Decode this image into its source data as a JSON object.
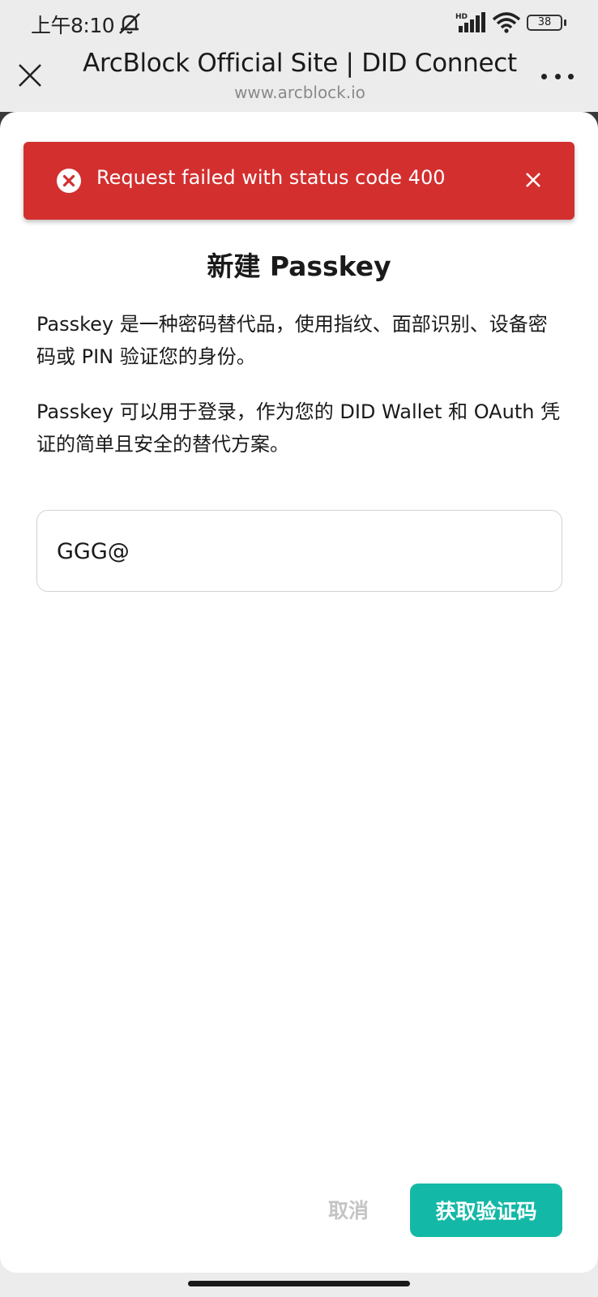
{
  "status_bar": {
    "time": "上午8:10",
    "battery": "38",
    "network_label": "HD"
  },
  "header": {
    "title": "ArcBlock Official Site | DID Connect",
    "url": "www.arcblock.io"
  },
  "toast": {
    "message": "Request failed with status code 400",
    "color": "#d32f2f"
  },
  "dialog": {
    "title": "新建 Passkey",
    "paragraph1": "Passkey 是一种密码替代品，使用指纹、面部识别、设备密码或 PIN 验证您的身份。",
    "paragraph2": "Passkey 可以用于登录，作为您的 DID Wallet 和 OAuth 凭证的简单且安全的替代方案。",
    "input_value": "GGG@",
    "cancel_label": "取消",
    "submit_label": "获取验证码",
    "accent": "#14b8a6"
  }
}
